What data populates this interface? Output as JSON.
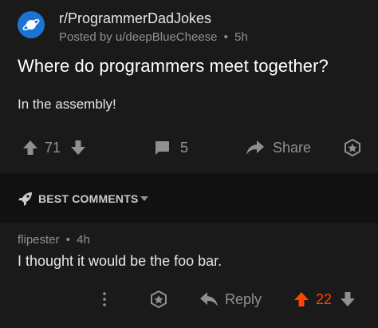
{
  "post": {
    "subreddit": "r/ProgrammerDadJokes",
    "posted_by_prefix": "Posted by",
    "author": "u/deepBlueCheese",
    "separator": "•",
    "age": "5h",
    "title": "Where do programmers meet together?",
    "body": "In the assembly!",
    "votes": "71",
    "comments": "5",
    "share_label": "Share",
    "icons": {
      "avatar": "planet-icon",
      "upvote": "upvote-arrow-icon",
      "downvote": "downvote-arrow-icon",
      "comment": "comment-bubble-icon",
      "share": "share-arrow-icon",
      "award": "award-badge-icon"
    }
  },
  "best_comments": {
    "label": "BEST COMMENTS",
    "icons": {
      "sort": "rocket-icon",
      "dropdown": "chevron-down-icon"
    }
  },
  "comment": {
    "author": "flipester",
    "separator": "•",
    "age": "4h",
    "text": "I thought it would be the foo bar.",
    "reply_label": "Reply",
    "votes": "22",
    "icons": {
      "more": "more-vertical-icon",
      "award": "award-badge-icon",
      "reply": "reply-arrow-icon",
      "upvote": "upvote-arrow-icon",
      "downvote": "downvote-arrow-icon"
    }
  },
  "colors": {
    "background": "#1a1a1b",
    "divider": "#111111",
    "avatar": "#1b74d4",
    "upvoted": "#ff4500",
    "muted": "#8e9194"
  }
}
